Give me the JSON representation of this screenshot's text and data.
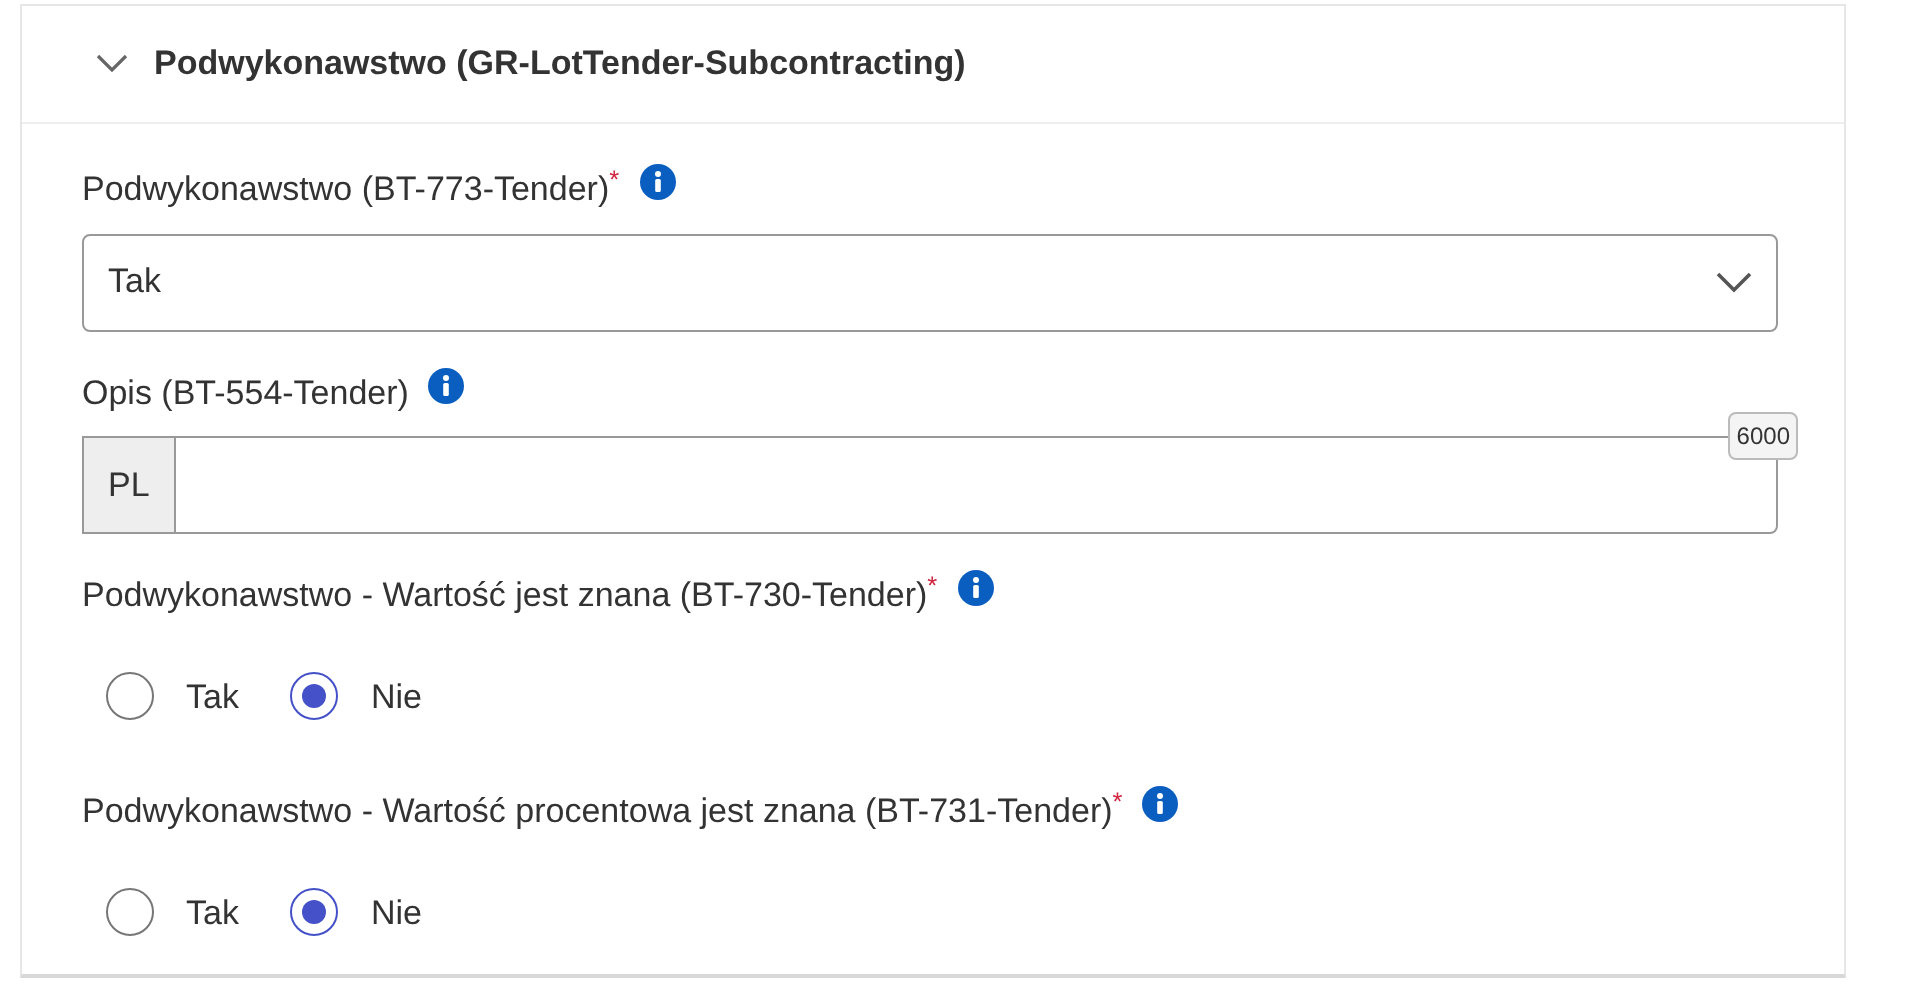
{
  "section": {
    "title": "Podwykonawstwo (GR-LotTender-Subcontracting)",
    "expanded": true
  },
  "fields": [
    {
      "kind": "select",
      "label": "Podwykonawstwo (BT-773-Tender)",
      "required_mark": "*",
      "value": "Tak"
    },
    {
      "kind": "text_lang",
      "label": "Opis (BT-554-Tender)",
      "language": "PL",
      "counter": "6000"
    },
    {
      "kind": "radio",
      "label": "Podwykonawstwo - Wartość jest znana (BT-730-Tender)",
      "required_mark": "*",
      "options": [
        {
          "label": "Tak",
          "selected": false
        },
        {
          "label": "Nie",
          "selected": true
        }
      ]
    },
    {
      "kind": "radio",
      "label": "Podwykonawstwo - Wartość procentowa jest znana (BT-731-Tender)",
      "required_mark": "*",
      "options": [
        {
          "label": "Tak",
          "selected": false
        },
        {
          "label": "Nie",
          "selected": true
        }
      ]
    }
  ]
}
